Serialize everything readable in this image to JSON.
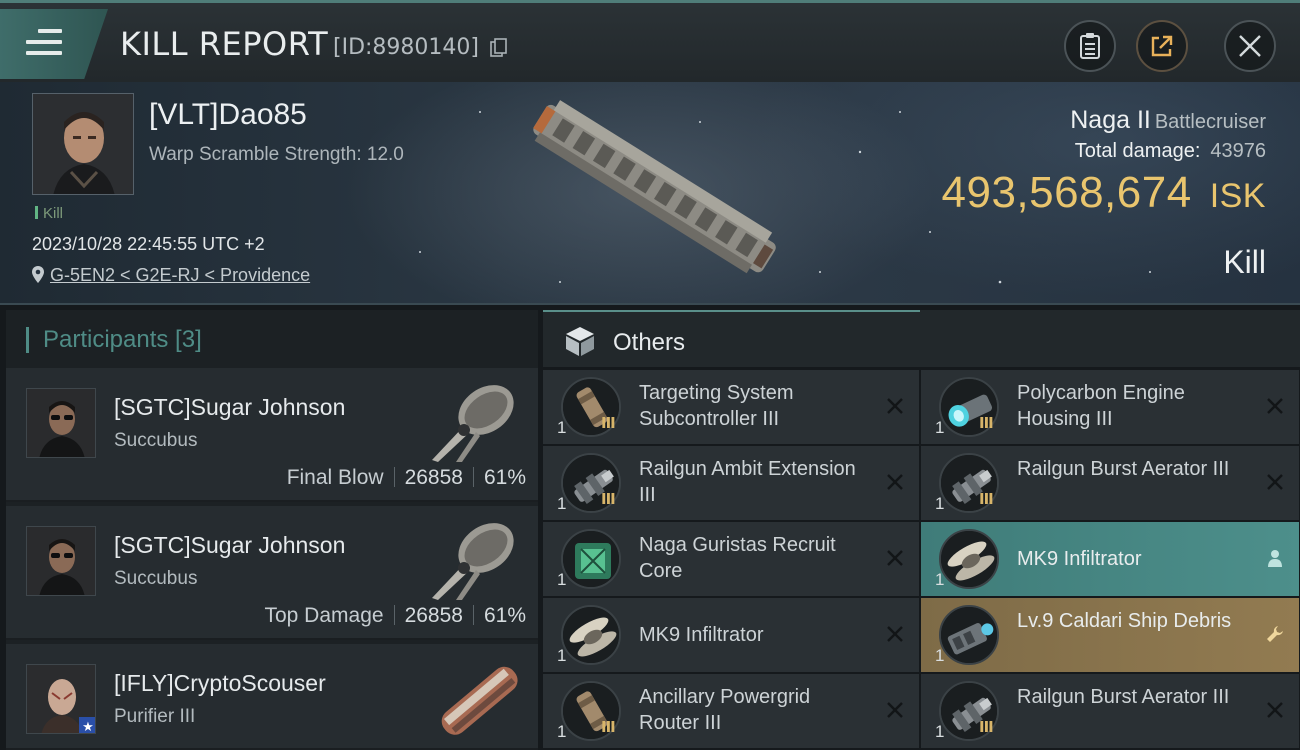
{
  "header": {
    "title": "KILL REPORT",
    "report_id": "[ID:8980140]"
  },
  "victim": {
    "name": "[VLT]Dao85",
    "warp_scramble": "Warp Scramble Strength: 12.0",
    "tag": "Kill",
    "timestamp": "2023/10/28 22:45:55 UTC +2",
    "location": "G-5EN2 < G2E-RJ < Providence",
    "ship_name": "Naga II",
    "ship_class": "Battlecruiser",
    "total_damage_label": "Total damage:",
    "total_damage": "43976",
    "isk_value": "493,568,674",
    "isk_unit": "ISK",
    "result": "Kill"
  },
  "participants": {
    "title": "Participants [3]",
    "rows": [
      {
        "name": "[SGTC]Sugar Johnson",
        "ship": "Succubus",
        "label": "Final Blow",
        "damage": "26858",
        "percent": "61%"
      },
      {
        "name": "[SGTC]Sugar Johnson",
        "ship": "Succubus",
        "label": "Top Damage",
        "damage": "26858",
        "percent": "61%"
      },
      {
        "name": "[IFLY]CryptoScouser",
        "ship": "Purifier III"
      }
    ]
  },
  "others": {
    "title": "Others",
    "items": [
      {
        "name": "Targeting System Subcontroller III",
        "qty": "1",
        "meta": "III",
        "state": "destroyed",
        "icon": "cylinder-module-icon"
      },
      {
        "name": "Polycarbon Engine Housing III",
        "qty": "1",
        "meta": "III",
        "state": "destroyed",
        "icon": "engine-module-icon"
      },
      {
        "name": "Railgun Ambit Extension III",
        "qty": "1",
        "meta": "III",
        "state": "destroyed",
        "icon": "railgun-module-icon"
      },
      {
        "name": "Railgun Burst Aerator III",
        "qty": "1",
        "meta": "III",
        "state": "destroyed",
        "icon": "railgun-module-icon"
      },
      {
        "name": "Naga Guristas Recruit Core",
        "qty": "1",
        "meta": "",
        "state": "destroyed",
        "icon": "core-chip-icon"
      },
      {
        "name": "MK9  Infiltrator",
        "qty": "1",
        "meta": "",
        "state": "dropped",
        "icon": "drone-icon"
      },
      {
        "name": "MK9  Infiltrator",
        "qty": "1",
        "meta": "",
        "state": "destroyed",
        "icon": "drone-icon"
      },
      {
        "name": "Lv.9 Caldari Ship Debris",
        "qty": "1",
        "meta": "",
        "state": "salvage",
        "icon": "debris-icon"
      },
      {
        "name": "Ancillary Powergrid Router III",
        "qty": "1",
        "meta": "III",
        "state": "destroyed",
        "icon": "cylinder-module-icon"
      },
      {
        "name": "Railgun Burst Aerator III",
        "qty": "1",
        "meta": "III",
        "state": "destroyed",
        "icon": "railgun-module-icon"
      }
    ]
  },
  "colors": {
    "accent_teal": "#4f8c86",
    "isk_gold": "#e9c56e",
    "dropped_bg": "#4d8f8b",
    "salvage_bg": "#927b51"
  }
}
